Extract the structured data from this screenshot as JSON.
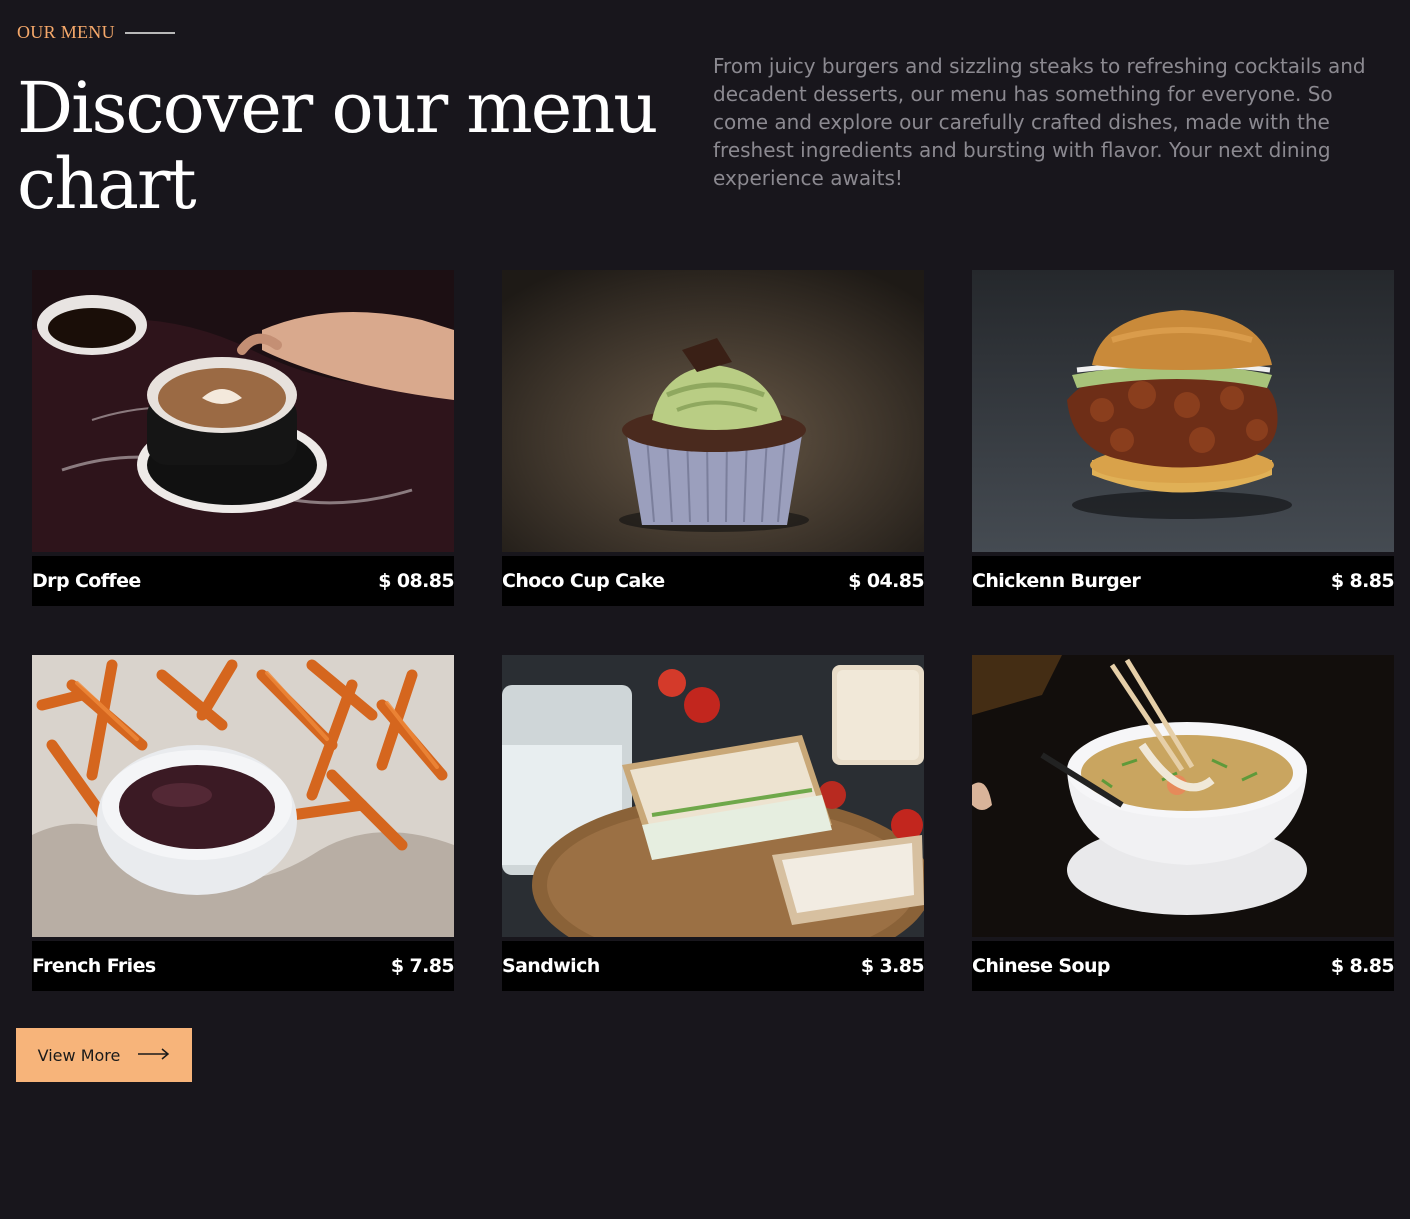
{
  "header": {
    "eyebrow": "OUR MENU",
    "title": "Discover our menu chart",
    "intro": "From juicy burgers and sizzling steaks to refreshing cocktails and decadent desserts, our menu has something for everyone. So come and explore our carefully crafted dishes, made with the freshest ingredients and bursting with flavor. Your next dining experience awaits!"
  },
  "menu": {
    "items": [
      {
        "name": "Drp Coffee",
        "price": "$ 08.85",
        "image": "coffee-cup"
      },
      {
        "name": "Choco Cup Cake",
        "price": "$ 04.85",
        "image": "cupcake"
      },
      {
        "name": "Chickenn Burger",
        "price": "$ 8.85",
        "image": "chicken-burger"
      },
      {
        "name": "French Fries",
        "price": "$ 7.85",
        "image": "french-fries"
      },
      {
        "name": "Sandwich",
        "price": "$ 3.85",
        "image": "sandwich"
      },
      {
        "name": "Chinese Soup",
        "price": "$ 8.85",
        "image": "chinese-soup"
      }
    ]
  },
  "cta": {
    "label": "View More",
    "icon": "arrow-right-icon"
  },
  "colors": {
    "background": "#18161c",
    "accent": "#f5a86a",
    "button": "#f7b47a",
    "caption_bg": "#000000"
  }
}
